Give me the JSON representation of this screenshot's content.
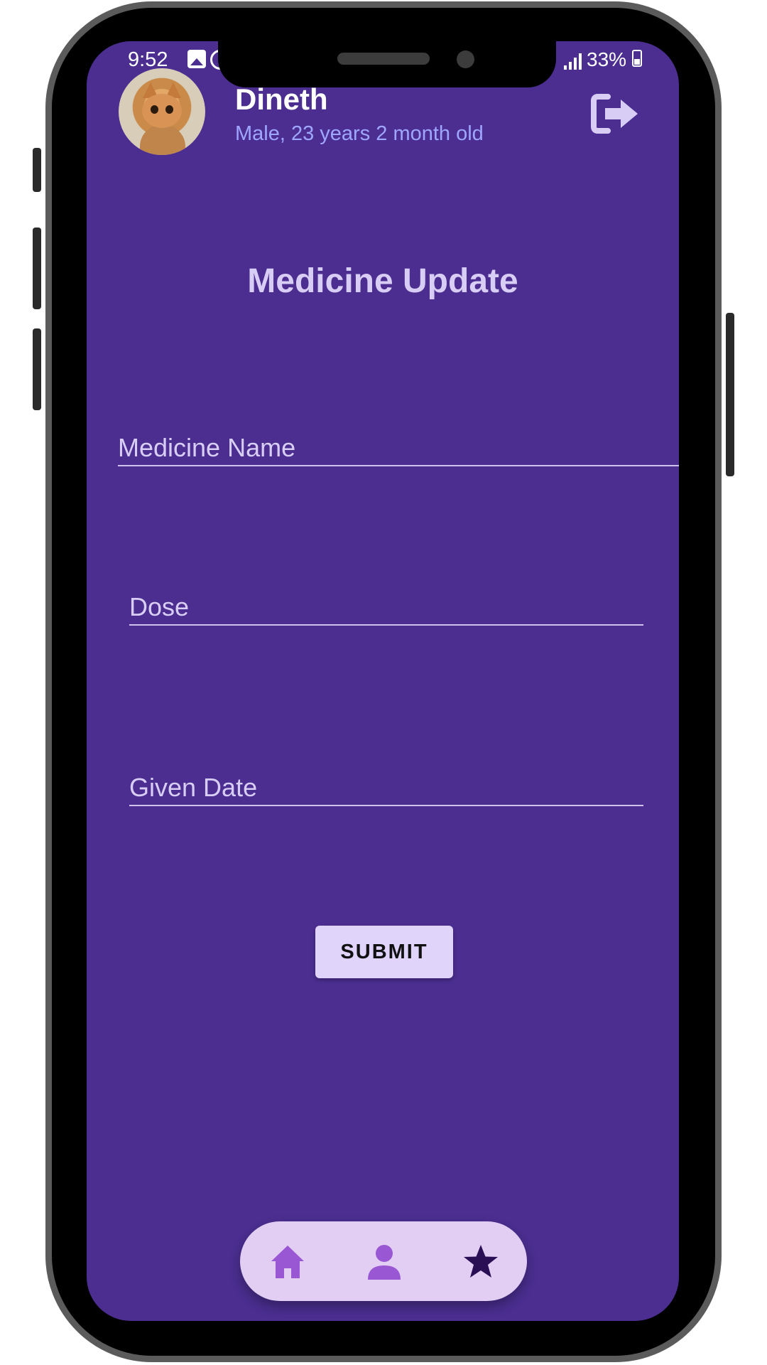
{
  "status_bar": {
    "time": "9:52",
    "battery": "33%",
    "icons": [
      "gallery-icon",
      "whatsapp-icon",
      "signal-icon",
      "battery-icon"
    ]
  },
  "header": {
    "name": "Dineth",
    "details": "Male, 23 years 2 month old",
    "logout_icon": "logout-icon"
  },
  "page": {
    "title": "Medicine Update"
  },
  "form": {
    "medicine_name_placeholder": "Medicine Name",
    "dose_placeholder": "Dose",
    "given_date_placeholder": "Given Date",
    "submit_label": "SUBMIT"
  },
  "bottom_nav": {
    "items": [
      {
        "icon": "home-icon"
      },
      {
        "icon": "person-icon"
      },
      {
        "icon": "star-icon"
      }
    ]
  },
  "colors": {
    "screen_bg": "#4b2e90",
    "accent_light": "#e0d4fb",
    "subtitle": "#9fa6ff"
  }
}
